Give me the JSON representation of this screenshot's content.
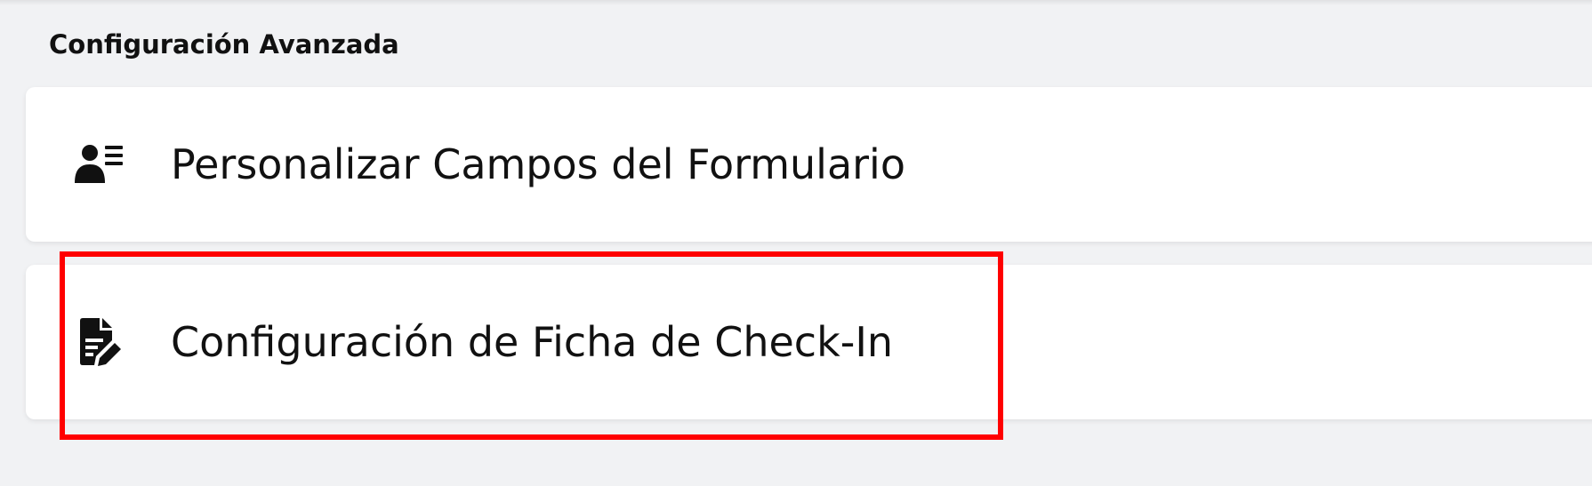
{
  "section": {
    "title": "Configuración Avanzada"
  },
  "items": [
    {
      "label": "Personalizar Campos del Formulario",
      "icon": "user-list-icon"
    },
    {
      "label": "Configuración de Ficha de Check-In",
      "icon": "file-edit-icon"
    }
  ],
  "highlight": {
    "color": "#ff0000",
    "target": "Configuración de Ficha de Check-In"
  }
}
